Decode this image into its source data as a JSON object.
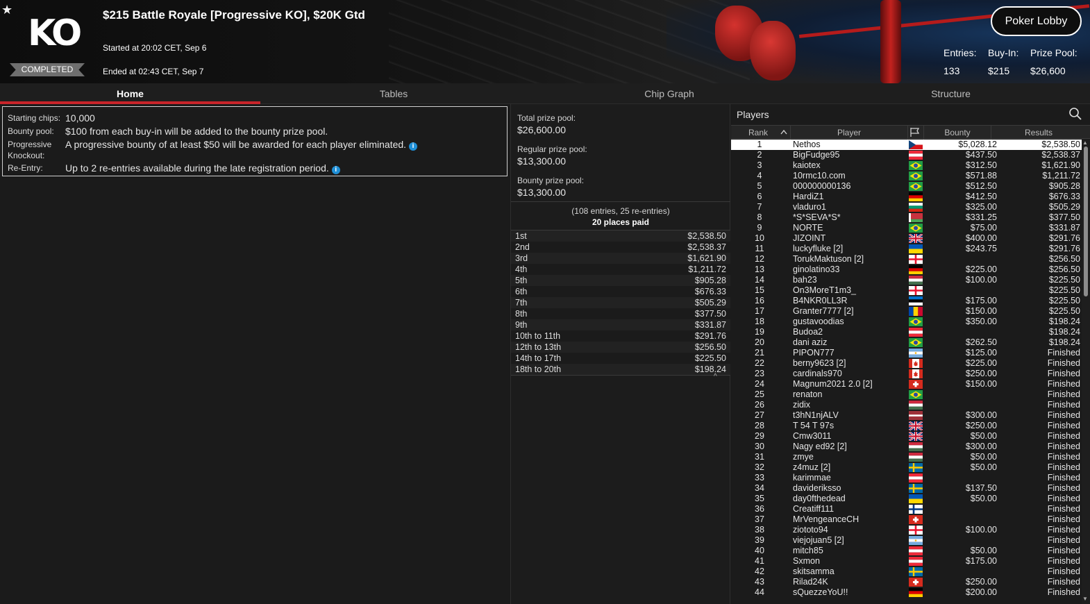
{
  "header": {
    "title": "$215 Battle Royale [Progressive KO], $20K Gtd",
    "started": "Started at 20:02 CET, Sep 6",
    "ended": "Ended at 02:43 CET, Sep 7",
    "status": "COMPLETED",
    "logo": "KO",
    "lobby_button": "Poker Lobby",
    "stats": {
      "entries_label": "Entries:",
      "entries_value": "133",
      "buyin_label": "Buy-In:",
      "buyin_value": "$215",
      "prizepool_label": "Prize Pool:",
      "prizepool_value": "$26,600"
    }
  },
  "tabs": [
    "Home",
    "Tables",
    "Chip Graph",
    "Structure"
  ],
  "info": {
    "starting_chips_label": "Starting chips:",
    "starting_chips_value": "10,000",
    "bounty_pool_label": "Bounty pool:",
    "bounty_pool_value": "$100 from each buy-in will be added to the bounty prize pool.",
    "pko_label_1": "Progressive",
    "pko_label_2": "Knockout:",
    "pko_value": "A progressive bounty of at least $50 will be awarded for each player eliminated.",
    "reentry_label": "Re-Entry:",
    "reentry_value": "Up to 2 re-entries available during the late registration period."
  },
  "prize": {
    "total_label": "Total prize pool:",
    "total_value": "$26,600.00",
    "regular_label": "Regular prize pool:",
    "regular_value": "$13,300.00",
    "bounty_label": "Bounty prize pool:",
    "bounty_value": "$13,300.00",
    "entries_text": "(108 entries, 25 re-entries)",
    "places_text": "20 places paid",
    "payouts": [
      {
        "place": "1st",
        "amount": "$2,538.50"
      },
      {
        "place": "2nd",
        "amount": "$2,538.37"
      },
      {
        "place": "3rd",
        "amount": "$1,621.90"
      },
      {
        "place": "4th",
        "amount": "$1,211.72"
      },
      {
        "place": "5th",
        "amount": "$905.28"
      },
      {
        "place": "6th",
        "amount": "$676.33"
      },
      {
        "place": "7th",
        "amount": "$505.29"
      },
      {
        "place": "8th",
        "amount": "$377.50"
      },
      {
        "place": "9th",
        "amount": "$331.87"
      },
      {
        "place": "10th to 11th",
        "amount": "$291.76"
      },
      {
        "place": "12th to 13th",
        "amount": "$256.50"
      },
      {
        "place": "14th to 17th",
        "amount": "$225.50"
      },
      {
        "place": "18th to 20th",
        "amount": "$198.24"
      }
    ]
  },
  "players": {
    "title": "Players",
    "columns": {
      "rank": "Rank",
      "player": "Player",
      "bounty": "Bounty",
      "results": "Results"
    },
    "rows": [
      {
        "rank": "1",
        "name": "Nethos",
        "flag": "cz",
        "bounty": "$5,028.12",
        "result": "$2,538.50"
      },
      {
        "rank": "2",
        "name": "BigFudge95",
        "flag": "at",
        "bounty": "$437.50",
        "result": "$2,538.37"
      },
      {
        "rank": "3",
        "name": "kaiotex",
        "flag": "br",
        "bounty": "$312.50",
        "result": "$1,621.90"
      },
      {
        "rank": "4",
        "name": "10rmc10.com",
        "flag": "br",
        "bounty": "$571.88",
        "result": "$1,211.72"
      },
      {
        "rank": "5",
        "name": "000000000136",
        "flag": "br",
        "bounty": "$512.50",
        "result": "$905.28"
      },
      {
        "rank": "6",
        "name": "HardiZ1",
        "flag": "de",
        "bounty": "$412.50",
        "result": "$676.33"
      },
      {
        "rank": "7",
        "name": "vladuro1",
        "flag": "bg",
        "bounty": "$325.00",
        "result": "$505.29"
      },
      {
        "rank": "8",
        "name": "*S*SEVA*S*",
        "flag": "by",
        "bounty": "$331.25",
        "result": "$377.50"
      },
      {
        "rank": "9",
        "name": "NORTE",
        "flag": "br",
        "bounty": "$75.00",
        "result": "$331.87"
      },
      {
        "rank": "10",
        "name": "JIZOINT",
        "flag": "gb",
        "bounty": "$400.00",
        "result": "$291.76"
      },
      {
        "rank": "11",
        "name": "luckyfluke [2]",
        "flag": "ua",
        "bounty": "$243.75",
        "result": "$291.76"
      },
      {
        "rank": "12",
        "name": "TorukMaktuson [2]",
        "flag": "ge",
        "bounty": "",
        "result": "$256.50"
      },
      {
        "rank": "13",
        "name": "ginolatino33",
        "flag": "de",
        "bounty": "$225.00",
        "result": "$256.50"
      },
      {
        "rank": "14",
        "name": "bah23",
        "flag": "hu",
        "bounty": "$100.00",
        "result": "$225.50"
      },
      {
        "rank": "15",
        "name": "On3MoreT1m3_",
        "flag": "ge",
        "bounty": "",
        "result": "$225.50"
      },
      {
        "rank": "16",
        "name": "B4NKR0LL3R",
        "flag": "ee",
        "bounty": "$175.00",
        "result": "$225.50"
      },
      {
        "rank": "17",
        "name": "Granter7777 [2]",
        "flag": "md",
        "bounty": "$150.00",
        "result": "$225.50"
      },
      {
        "rank": "18",
        "name": "gustavoodias",
        "flag": "br",
        "bounty": "$350.00",
        "result": "$198.24"
      },
      {
        "rank": "19",
        "name": "Budoa2",
        "flag": "at",
        "bounty": "",
        "result": "$198.24"
      },
      {
        "rank": "20",
        "name": "dani aziz",
        "flag": "br",
        "bounty": "$262.50",
        "result": "$198.24"
      },
      {
        "rank": "21",
        "name": "PIPON777",
        "flag": "ar",
        "bounty": "$125.00",
        "result": "Finished"
      },
      {
        "rank": "22",
        "name": "berny9623 [2]",
        "flag": "ca",
        "bounty": "$225.00",
        "result": "Finished"
      },
      {
        "rank": "23",
        "name": "cardinals970",
        "flag": "ca",
        "bounty": "$250.00",
        "result": "Finished"
      },
      {
        "rank": "24",
        "name": "Magnum2021 2.0 [2]",
        "flag": "ch",
        "bounty": "$150.00",
        "result": "Finished"
      },
      {
        "rank": "25",
        "name": "renaton",
        "flag": "br",
        "bounty": "",
        "result": "Finished"
      },
      {
        "rank": "26",
        "name": "zidix",
        "flag": "hu",
        "bounty": "",
        "result": "Finished"
      },
      {
        "rank": "27",
        "name": "t3hN1njALV",
        "flag": "lv",
        "bounty": "$300.00",
        "result": "Finished"
      },
      {
        "rank": "28",
        "name": "T 54 T 97s",
        "flag": "gb",
        "bounty": "$250.00",
        "result": "Finished"
      },
      {
        "rank": "29",
        "name": "Cmw3011",
        "flag": "gb",
        "bounty": "$50.00",
        "result": "Finished"
      },
      {
        "rank": "30",
        "name": "Nagy ed92 [2]",
        "flag": "hu",
        "bounty": "$300.00",
        "result": "Finished"
      },
      {
        "rank": "31",
        "name": "zmye",
        "flag": "hu",
        "bounty": "$50.00",
        "result": "Finished"
      },
      {
        "rank": "32",
        "name": "z4muz [2]",
        "flag": "se",
        "bounty": "$50.00",
        "result": "Finished"
      },
      {
        "rank": "33",
        "name": "karimmae",
        "flag": "at",
        "bounty": "",
        "result": "Finished"
      },
      {
        "rank": "34",
        "name": "davideriksso",
        "flag": "se",
        "bounty": "$137.50",
        "result": "Finished"
      },
      {
        "rank": "35",
        "name": "day0fthedead",
        "flag": "ua",
        "bounty": "$50.00",
        "result": "Finished"
      },
      {
        "rank": "36",
        "name": "Creatiff111",
        "flag": "fi",
        "bounty": "",
        "result": "Finished"
      },
      {
        "rank": "37",
        "name": "MrVengeanceCH",
        "flag": "ch",
        "bounty": "",
        "result": "Finished"
      },
      {
        "rank": "38",
        "name": "ziototo94",
        "flag": "ge",
        "bounty": "$100.00",
        "result": "Finished"
      },
      {
        "rank": "39",
        "name": "viejojuan5 [2]",
        "flag": "ar",
        "bounty": "",
        "result": "Finished"
      },
      {
        "rank": "40",
        "name": "mitch85",
        "flag": "at",
        "bounty": "$50.00",
        "result": "Finished"
      },
      {
        "rank": "41",
        "name": "Sxmon",
        "flag": "at",
        "bounty": "$175.00",
        "result": "Finished"
      },
      {
        "rank": "42",
        "name": "skitsamma",
        "flag": "se",
        "bounty": "",
        "result": "Finished"
      },
      {
        "rank": "43",
        "name": "Rilad24K",
        "flag": "ch",
        "bounty": "$250.00",
        "result": "Finished"
      },
      {
        "rank": "44",
        "name": "sQuezzeYoU!!",
        "flag": "de",
        "bounty": "$200.00",
        "result": "Finished"
      }
    ]
  },
  "colors": {
    "accent": "#c8252a",
    "info_icon": "#1f8fd6",
    "badge": "#6f6f6f"
  }
}
